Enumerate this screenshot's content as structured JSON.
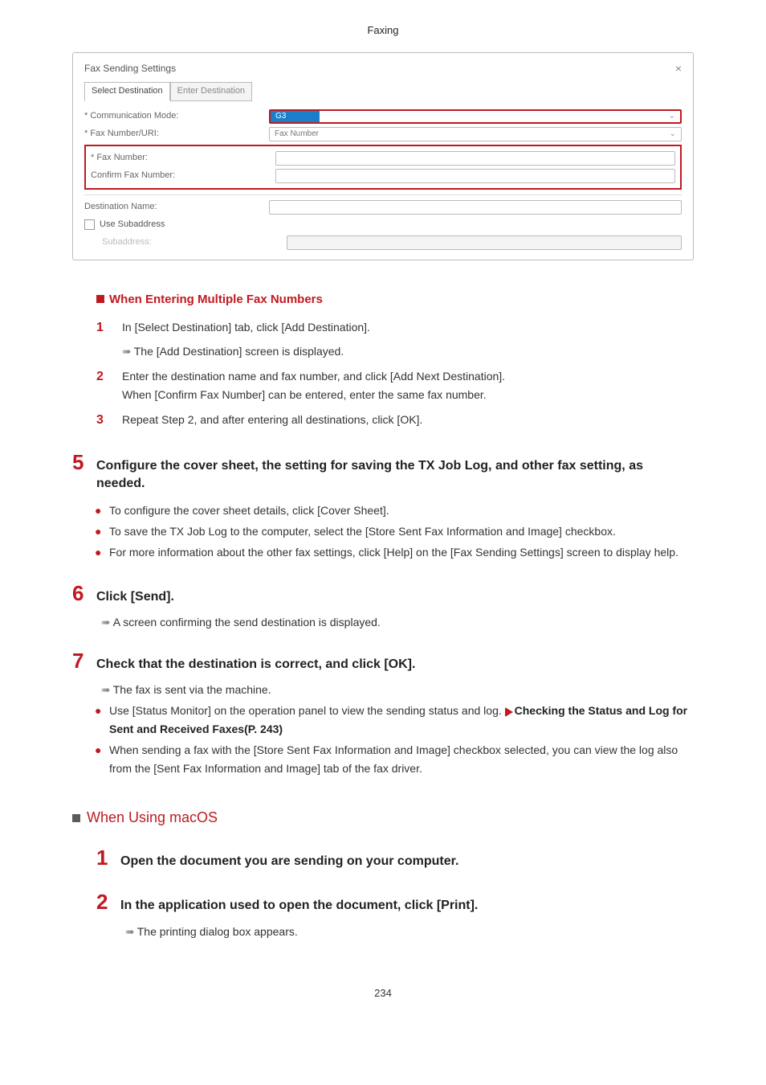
{
  "header": {
    "title": "Faxing"
  },
  "screenshot": {
    "window_title": "Fax Sending Settings",
    "tabs": {
      "active": "Select Destination",
      "inactive": "Enter Destination"
    },
    "rows": {
      "comm_mode_label": "* Communication Mode:",
      "comm_mode_value": "G3",
      "fax_uri_label": "* Fax Number/URI:",
      "fax_uri_value": "Fax Number",
      "fax_number_label": "* Fax Number:",
      "confirm_label": "Confirm Fax Number:",
      "dest_name_label": "Destination Name:",
      "use_sub_label": "Use Subaddress",
      "subaddress_label": "Subaddress:"
    }
  },
  "sub_a": {
    "title": "When Entering Multiple Fax Numbers",
    "s1": {
      "num": "1",
      "line1": "In [Select Destination] tab, click [Add Destination].",
      "line2": "The [Add Destination] screen is displayed."
    },
    "s2": {
      "num": "2",
      "line1": "Enter the destination name and fax number, and click [Add Next Destination].",
      "line2": "When [Confirm Fax Number] can be entered, enter the same fax number."
    },
    "s3": {
      "num": "3",
      "line1": "Repeat Step 2, and after entering all destinations, click [OK]."
    }
  },
  "step5": {
    "num": "5",
    "title": "Configure the cover sheet, the setting for saving the TX Job Log, and other fax setting, as needed.",
    "b1": "To configure the cover sheet details, click [Cover Sheet].",
    "b2": "To save the TX Job Log to the computer, select the [Store Sent Fax Information and Image] checkbox.",
    "b3": "For more information about the other fax settings, click [Help] on the [Fax Sending Settings] screen to display help."
  },
  "step6": {
    "num": "6",
    "title": "Click [Send].",
    "result": "A screen confirming the send destination is displayed."
  },
  "step7": {
    "num": "7",
    "title": "Check that the destination is correct, and click [OK].",
    "result": "The fax is sent via the machine.",
    "b1_pre": "Use [Status Monitor] on the operation panel to view the sending status and log. ",
    "b1_link": "Checking the Status and Log for Sent and Received Faxes(P. 243)",
    "b2": "When sending a fax with the [Store Sent Fax Information and Image] checkbox selected, you can view the log also from the [Sent Fax Information and Image] tab of the fax driver."
  },
  "macos": {
    "heading": "When Using macOS",
    "s1": {
      "num": "1",
      "title": "Open the document you are sending on your computer."
    },
    "s2": {
      "num": "2",
      "title": "In the application used to open the document, click [Print].",
      "result": "The printing dialog box appears."
    }
  },
  "page_number": "234"
}
